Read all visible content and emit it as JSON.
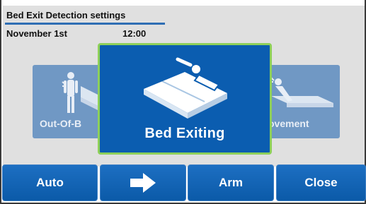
{
  "header": {
    "title": "Bed Exit Detection settings",
    "date": "November 1st",
    "time": "12:00"
  },
  "tiles": {
    "left": {
      "label": "Out-Of-B"
    },
    "right": {
      "label": "ovement"
    }
  },
  "modal": {
    "label": "Bed Exiting",
    "icon": "bed-exiting-icon",
    "border_color": "#8ed05a",
    "background_color": "#0b5db0"
  },
  "toolbar": {
    "auto_label": "Auto",
    "next_icon": "arrow-right-icon",
    "arm_label": "Arm",
    "close_label": "Close"
  },
  "colors": {
    "accent": "#2f6eb4",
    "tile": "#7098c4",
    "button": "#0b5aa8"
  }
}
